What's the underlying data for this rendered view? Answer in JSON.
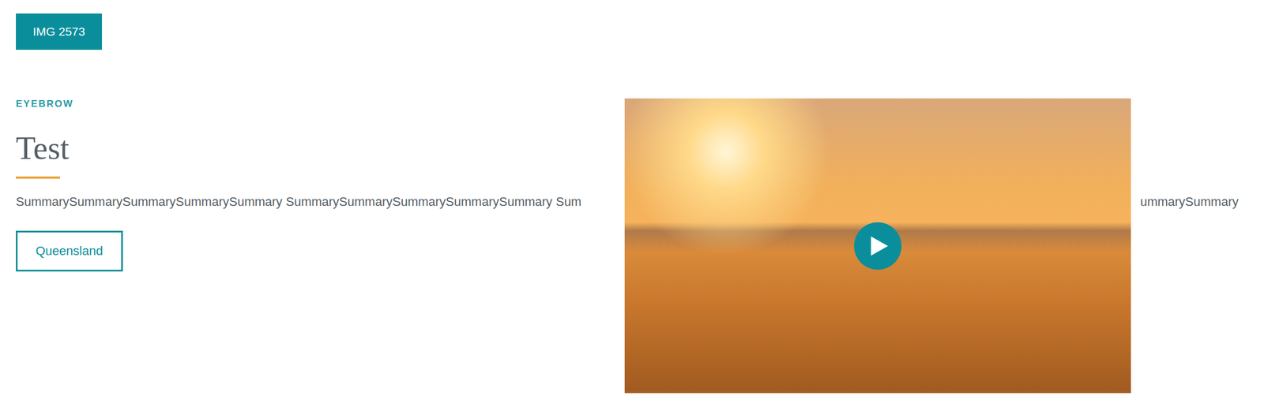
{
  "top_button": {
    "label": "IMG 2573"
  },
  "hero": {
    "eyebrow": "EYEBROW",
    "title": "Test",
    "summary": [
      "SummarySummarySummarySummarySummary SummarySummarySummarySummarySummary Sum",
      "ummarySummary"
    ],
    "tag": "Queensland",
    "video": {
      "playing": false
    }
  }
}
